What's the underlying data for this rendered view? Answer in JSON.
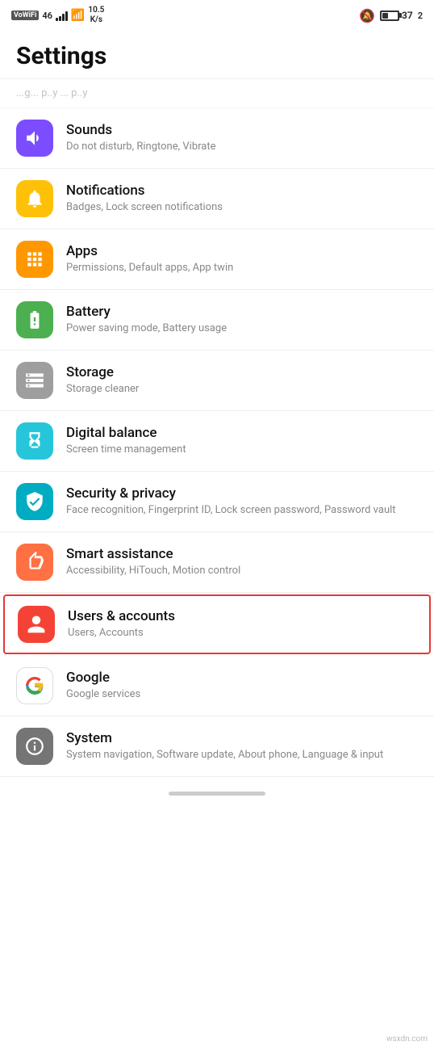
{
  "statusBar": {
    "left": {
      "vowifi": "VoWiFi",
      "signal": "4G",
      "speed": "10.5\nK/s"
    },
    "right": {
      "bell": "🔕",
      "battery_pct": "37",
      "bars": "2"
    }
  },
  "header": {
    "title": "Settings"
  },
  "partialItem": {
    "text": "..g... p..y ... p..y"
  },
  "items": [
    {
      "id": "sounds",
      "title": "Sounds",
      "subtitle": "Do not disturb, Ringtone, Vibrate",
      "iconColor": "icon-purple",
      "iconType": "volume"
    },
    {
      "id": "notifications",
      "title": "Notifications",
      "subtitle": "Badges, Lock screen notifications",
      "iconColor": "icon-yellow",
      "iconType": "bell"
    },
    {
      "id": "apps",
      "title": "Apps",
      "subtitle": "Permissions, Default apps, App twin",
      "iconColor": "icon-orange-yellow",
      "iconType": "apps"
    },
    {
      "id": "battery",
      "title": "Battery",
      "subtitle": "Power saving mode, Battery usage",
      "iconColor": "icon-green",
      "iconType": "battery"
    },
    {
      "id": "storage",
      "title": "Storage",
      "subtitle": "Storage cleaner",
      "iconColor": "icon-gray",
      "iconType": "storage"
    },
    {
      "id": "digital-balance",
      "title": "Digital balance",
      "subtitle": "Screen time management",
      "iconColor": "icon-teal",
      "iconType": "hourglass"
    },
    {
      "id": "security-privacy",
      "title": "Security & privacy",
      "subtitle": "Face recognition, Fingerprint ID, Lock screen password, Password vault",
      "iconColor": "icon-teal-dark",
      "iconType": "shield"
    },
    {
      "id": "smart-assistance",
      "title": "Smart assistance",
      "subtitle": "Accessibility, HiTouch, Motion control",
      "iconColor": "icon-orange",
      "iconType": "hand"
    },
    {
      "id": "users-accounts",
      "title": "Users & accounts",
      "subtitle": "Users, Accounts",
      "iconColor": "icon-red",
      "iconType": "person",
      "highlighted": true
    },
    {
      "id": "google",
      "title": "Google",
      "subtitle": "Google services",
      "iconColor": "icon-google",
      "iconType": "google"
    },
    {
      "id": "system",
      "title": "System",
      "subtitle": "System navigation, Software update, About phone, Language & input",
      "iconColor": "icon-gray-dark",
      "iconType": "info"
    }
  ],
  "watermark": "wsxdn.com"
}
